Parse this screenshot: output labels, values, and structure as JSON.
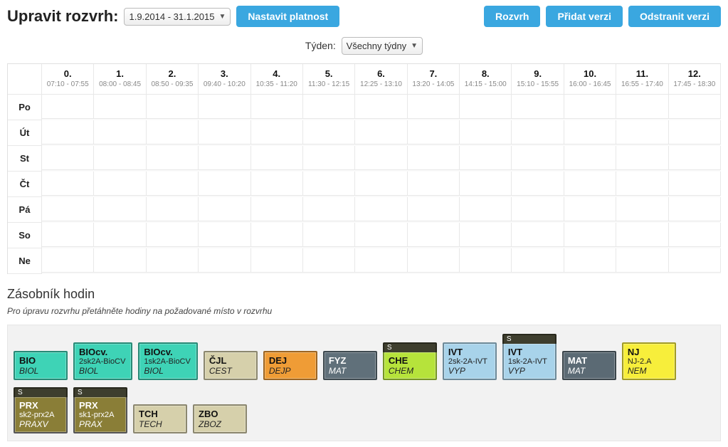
{
  "header": {
    "title": "Upravit rozvrh:",
    "date_range": "1.9.2014 - 31.1.2015",
    "btn_set_validity": "Nastavit platnost",
    "btn_schedule": "Rozvrh",
    "btn_add_version": "Přidat verzi",
    "btn_remove_version": "Odstranit verzi"
  },
  "week": {
    "label": "Týden:",
    "value": "Všechny týdny"
  },
  "periods": [
    {
      "num": "0.",
      "time": "07:10 - 07:55"
    },
    {
      "num": "1.",
      "time": "08:00 - 08:45"
    },
    {
      "num": "2.",
      "time": "08:50 - 09:35"
    },
    {
      "num": "3.",
      "time": "09:40 - 10:20"
    },
    {
      "num": "4.",
      "time": "10:35 - 11:20"
    },
    {
      "num": "5.",
      "time": "11:30 - 12:15"
    },
    {
      "num": "6.",
      "time": "12:25 - 13:10"
    },
    {
      "num": "7.",
      "time": "13:20 - 14:05"
    },
    {
      "num": "8.",
      "time": "14:15 - 15:00"
    },
    {
      "num": "9.",
      "time": "15:10 - 15:55"
    },
    {
      "num": "10.",
      "time": "16:00 - 16:45"
    },
    {
      "num": "11.",
      "time": "16:55 - 17:40"
    },
    {
      "num": "12.",
      "time": "17:45 - 18:30"
    }
  ],
  "days": [
    "Po",
    "Út",
    "St",
    "Čt",
    "Pá",
    "So",
    "Ne"
  ],
  "stash": {
    "title": "Zásobník hodin",
    "hint": "Pro úpravu rozvrhu přetáhněte hodiny na požadované místo v rozvrhu"
  },
  "s_label": "S",
  "lessons_row1": [
    {
      "title": "BIO",
      "group": "",
      "room": "BIOL",
      "color": "c-teal",
      "s": false
    },
    {
      "title": "BIOcv.",
      "group": "2sk2A-BioCV",
      "room": "BIOL",
      "color": "c-teal",
      "s": false
    },
    {
      "title": "BIOcv.",
      "group": "1sk2A-BioCV",
      "room": "BIOL",
      "color": "c-teal",
      "s": false
    },
    {
      "title": "ČJL",
      "group": "",
      "room": "CEST",
      "color": "c-tan",
      "s": false
    },
    {
      "title": "DEJ",
      "group": "",
      "room": "DEJP",
      "color": "c-orange",
      "s": false
    },
    {
      "title": "FYZ",
      "group": "",
      "room": "MAT",
      "color": "c-slate",
      "s": false
    },
    {
      "title": "CHE",
      "group": "",
      "room": "CHEM",
      "color": "c-lime",
      "s": true
    },
    {
      "title": "IVT",
      "group": "2sk-2A-IVT",
      "room": "VYP",
      "color": "c-blue",
      "s": false
    },
    {
      "title": "IVT",
      "group": "1sk-2A-IVT",
      "room": "VYP",
      "color": "c-blue",
      "s": true
    },
    {
      "title": "MAT",
      "group": "",
      "room": "MAT",
      "color": "c-slate2",
      "s": false
    },
    {
      "title": "NJ",
      "group": "NJ-2.A",
      "room": "NEM",
      "color": "c-yellow",
      "s": false
    }
  ],
  "lessons_row2": [
    {
      "title": "PRX",
      "group": "sk2-prx2A",
      "room": "PRAXV",
      "color": "c-olive",
      "s": true
    },
    {
      "title": "PRX",
      "group": "sk1-prx2A",
      "room": "PRAX",
      "color": "c-olive",
      "s": true
    },
    {
      "title": "TCH",
      "group": "",
      "room": "TECH",
      "color": "c-tan",
      "s": false
    },
    {
      "title": "ZBO",
      "group": "",
      "room": "ZBOZ",
      "color": "c-tan",
      "s": false
    }
  ]
}
